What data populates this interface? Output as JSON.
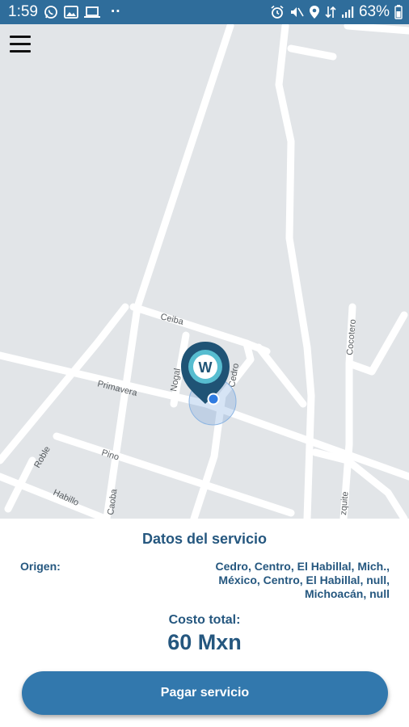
{
  "status_bar": {
    "time": "1:59",
    "battery": "63%",
    "dots": "··"
  },
  "map": {
    "streets": {
      "ceiba": "Ceiba",
      "primavera": "Primavera",
      "nogal": "Nogal",
      "cedro": "Cedro",
      "cocotero": "Cocotero",
      "roble": "Roble",
      "pino": "Pino",
      "habillo": "Habillo",
      "caoba": "Caoba",
      "mezquite": "zquite"
    },
    "marker_letter": "W"
  },
  "service": {
    "title": "Datos del servicio",
    "origin_label": "Origen:",
    "origin_value": "Cedro, Centro, El Habillal, Mich., México, Centro, El Habillal, null, Michoacán, null",
    "cost_label": "Costo total:",
    "cost_value": "60 Mxn",
    "pay_button": "Pagar servicio"
  },
  "colors": {
    "status_bar": "#2f6d9b",
    "map_background": "#e2e5e8",
    "road": "#ffffff",
    "text_accent": "#25577f",
    "button": "#3278ad"
  }
}
